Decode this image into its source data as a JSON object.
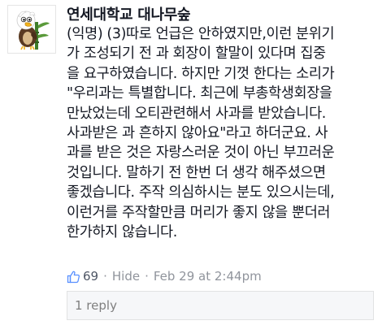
{
  "post": {
    "author": "연세대학교 대나무숲",
    "body_lines": [
      "(익명) (3)따로 언급은 안하였지만,이런 분위기",
      "가 조성되기 전 과 회장이 할말이 있다며 집중",
      "을 요구하였습니다. 하지만 기껏 한다는 소리가",
      "\"우리과는 특별합니다. 최근에 부총학생회장을",
      "만났었는데 오티관련해서 사과를 받았습니다.",
      "사과받은 과 흔하지 않아요\"라고 하더군요. 사",
      "과를 받은 것은 자랑스러운 것이 아닌 부끄러운",
      "것입니다. 말하기 전 한번 더 생각 해주셨으면",
      "좋겠습니다. 주작 의심하시는 분도 있으시는데,",
      "이런거를 주작할만큼 머리가 좋지 않을 뿐더러",
      "한가하지 않습니다."
    ]
  },
  "meta": {
    "like_icon": "thumbs-up-icon",
    "like_count": "69",
    "separator": "·",
    "hide_label": "Hide",
    "timestamp": "Feb 29 at 2:44pm"
  },
  "replies": {
    "label": "1 reply"
  },
  "colors": {
    "text": "#141823",
    "meta": "#90949c",
    "like_blue": "#5890ff",
    "reply_bg": "#f6f7f9"
  }
}
